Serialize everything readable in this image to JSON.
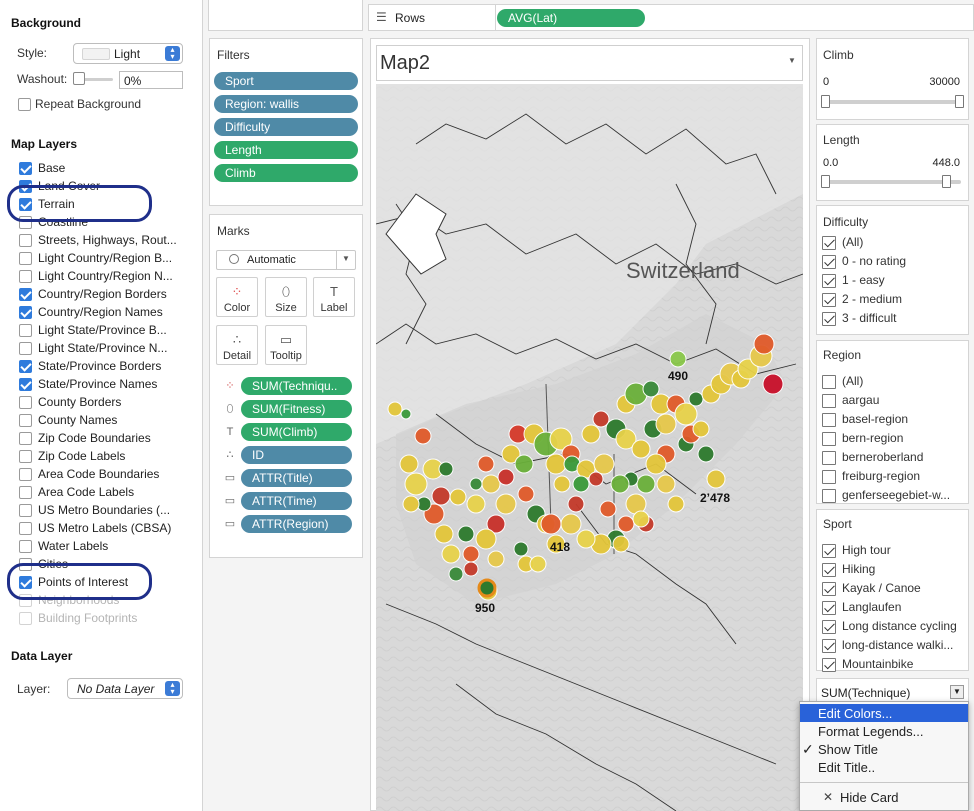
{
  "background": {
    "heading": "Background",
    "style_label": "Style:",
    "style_value": "Light",
    "washout_label": "Washout:",
    "washout_value": "0%",
    "washout_level": 0,
    "repeat_label": "Repeat Background",
    "repeat_checked": false
  },
  "map_layers": {
    "heading": "Map Layers",
    "items": [
      {
        "label": "Base",
        "checked": true,
        "dim": false
      },
      {
        "label": "Land Cover",
        "checked": true,
        "dim": false
      },
      {
        "label": "Terrain",
        "checked": true,
        "dim": false
      },
      {
        "label": "Coastline",
        "checked": false,
        "dim": false
      },
      {
        "label": "Streets, Highways, Rout...",
        "checked": false,
        "dim": false
      },
      {
        "label": "Light Country/Region B...",
        "checked": false,
        "dim": false
      },
      {
        "label": "Light Country/Region N...",
        "checked": false,
        "dim": false
      },
      {
        "label": "Country/Region Borders",
        "checked": true,
        "dim": false
      },
      {
        "label": "Country/Region Names",
        "checked": true,
        "dim": false
      },
      {
        "label": "Light State/Province B...",
        "checked": false,
        "dim": false
      },
      {
        "label": "Light State/Province N...",
        "checked": false,
        "dim": false
      },
      {
        "label": "State/Province Borders",
        "checked": true,
        "dim": false
      },
      {
        "label": "State/Province Names",
        "checked": true,
        "dim": false
      },
      {
        "label": "County Borders",
        "checked": false,
        "dim": false
      },
      {
        "label": "County Names",
        "checked": false,
        "dim": false
      },
      {
        "label": "Zip Code Boundaries",
        "checked": false,
        "dim": false
      },
      {
        "label": "Zip Code Labels",
        "checked": false,
        "dim": false
      },
      {
        "label": "Area Code Boundaries",
        "checked": false,
        "dim": false
      },
      {
        "label": "Area Code Labels",
        "checked": false,
        "dim": false
      },
      {
        "label": "US Metro Boundaries (...",
        "checked": false,
        "dim": false
      },
      {
        "label": "US Metro Labels (CBSA)",
        "checked": false,
        "dim": false
      },
      {
        "label": "Water Labels",
        "checked": false,
        "dim": false
      },
      {
        "label": "Cities",
        "checked": false,
        "dim": false
      },
      {
        "label": "Points of Interest",
        "checked": true,
        "dim": false
      },
      {
        "label": "Neighborhoods",
        "checked": false,
        "dim": true
      },
      {
        "label": "Building Footprints",
        "checked": false,
        "dim": true
      }
    ]
  },
  "data_layer": {
    "heading": "Data Layer",
    "layer_label": "Layer:",
    "layer_value": "No Data Layer"
  },
  "rows_shelf": {
    "label": "Rows",
    "pill": "AVG(Lat)"
  },
  "filters": {
    "title": "Filters",
    "pills": [
      {
        "label": "Sport",
        "color": "blue"
      },
      {
        "label": "Region: wallis",
        "color": "blue"
      },
      {
        "label": "Difficulty",
        "color": "blue"
      },
      {
        "label": "Length",
        "color": "green"
      },
      {
        "label": "Climb",
        "color": "green"
      }
    ]
  },
  "marks": {
    "title": "Marks",
    "mark_type": "Automatic",
    "buttons": [
      {
        "label": "Color",
        "icon": "color-dots-icon"
      },
      {
        "label": "Size",
        "icon": "size-icon"
      },
      {
        "label": "Label",
        "icon": "label-icon"
      },
      {
        "label": "Detail",
        "icon": "detail-icon"
      },
      {
        "label": "Tooltip",
        "icon": "tooltip-icon"
      }
    ],
    "fields": [
      {
        "icon": "color-dots-icon",
        "label": "SUM(Techniqu..",
        "color": "green"
      },
      {
        "icon": "size-icon",
        "label": "SUM(Fitness)",
        "color": "green"
      },
      {
        "icon": "label-icon",
        "label": "SUM(Climb)",
        "color": "green"
      },
      {
        "icon": "detail-icon",
        "label": "ID",
        "color": "blue"
      },
      {
        "icon": "tooltip-icon",
        "label": "ATTR(Title)",
        "color": "blue"
      },
      {
        "icon": "tooltip-icon",
        "label": "ATTR(Time)",
        "color": "blue"
      },
      {
        "icon": "tooltip-icon",
        "label": "ATTR(Region)",
        "color": "blue"
      }
    ]
  },
  "view": {
    "title": "Map2",
    "country_label": "Switzerland",
    "mark_labels": [
      "490",
      "2’478",
      "418",
      "950"
    ]
  },
  "climb_card": {
    "title": "Climb",
    "min": "0",
    "max": "30000"
  },
  "length_card": {
    "title": "Length",
    "min": "0.0",
    "max": "448.0"
  },
  "difficulty_card": {
    "title": "Difficulty",
    "items": [
      {
        "label": "(All)",
        "checked": true
      },
      {
        "label": "0 - no rating",
        "checked": true
      },
      {
        "label": "1 - easy",
        "checked": true
      },
      {
        "label": "2 - medium",
        "checked": true
      },
      {
        "label": "3 - difficult",
        "checked": true
      }
    ]
  },
  "region_card": {
    "title": "Region",
    "items": [
      {
        "label": "(All)",
        "checked": false
      },
      {
        "label": "aargau",
        "checked": false
      },
      {
        "label": "basel-region",
        "checked": false
      },
      {
        "label": "bern-region",
        "checked": false
      },
      {
        "label": "berneroberland",
        "checked": false
      },
      {
        "label": "freiburg-region",
        "checked": false
      },
      {
        "label": "genferseegebiet-w...",
        "checked": false
      }
    ]
  },
  "sport_card": {
    "title": "Sport",
    "items": [
      {
        "label": "High tour",
        "checked": true
      },
      {
        "label": "Hiking",
        "checked": true
      },
      {
        "label": "Kayak / Canoe",
        "checked": true
      },
      {
        "label": "Langlaufen",
        "checked": true
      },
      {
        "label": "Long distance cycling",
        "checked": true
      },
      {
        "label": "long-distance walki...",
        "checked": true
      },
      {
        "label": "Mountainbike",
        "checked": true
      }
    ]
  },
  "technique_card": {
    "title": "SUM(Technique)"
  },
  "context_menu": {
    "items": [
      "Edit Colors...",
      "Format Legends...",
      "Show Title",
      "Edit Title..",
      "Hide Card"
    ],
    "highlighted": "Edit Colors...",
    "checked": "Show Title"
  },
  "colors": {
    "accent_blue": "#2f7bdc",
    "pill_blue": "#4f8aa7",
    "pill_green": "#2fa96a",
    "highlight": "#1f2f8a",
    "menu_highlight": "#2962d9"
  }
}
